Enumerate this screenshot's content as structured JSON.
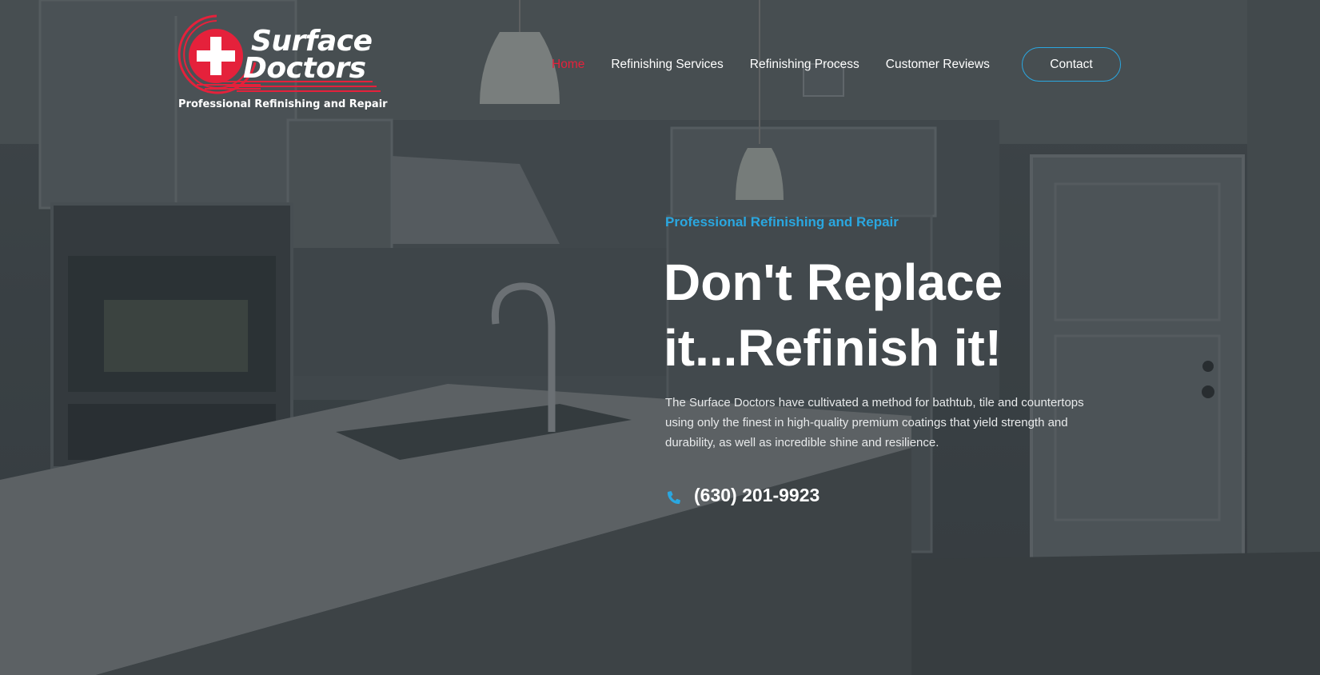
{
  "brand": {
    "name_line1": "Surface",
    "name_line2": "Doctors",
    "tagline": "Professional Refinishing and Repair",
    "logo_icon": "red-cross-badge-icon",
    "colors": {
      "red": "#e5213b",
      "white": "#ffffff"
    }
  },
  "nav": {
    "items": [
      {
        "label": "Home",
        "active": true
      },
      {
        "label": "Refinishing Services",
        "active": false
      },
      {
        "label": "Refinishing Process",
        "active": false
      },
      {
        "label": "Customer Reviews",
        "active": false
      }
    ],
    "contact_label": "Contact"
  },
  "hero": {
    "eyebrow": "Professional Refinishing and Repair",
    "headline_line1": "Don't Replace",
    "headline_line2": "it...Refinish it!",
    "description": "The Surface Doctors have cultivated a method for bathtub, tile and countertops using only the finest in high-quality premium coatings that yield strength and durability, as well as incredible shine and resilience.",
    "phone": "(630) 201-9923",
    "phone_icon": "phone-icon"
  },
  "colors": {
    "accent_blue": "#2aa7e0",
    "active_red": "#e5213b",
    "text_white": "#ffffff"
  }
}
